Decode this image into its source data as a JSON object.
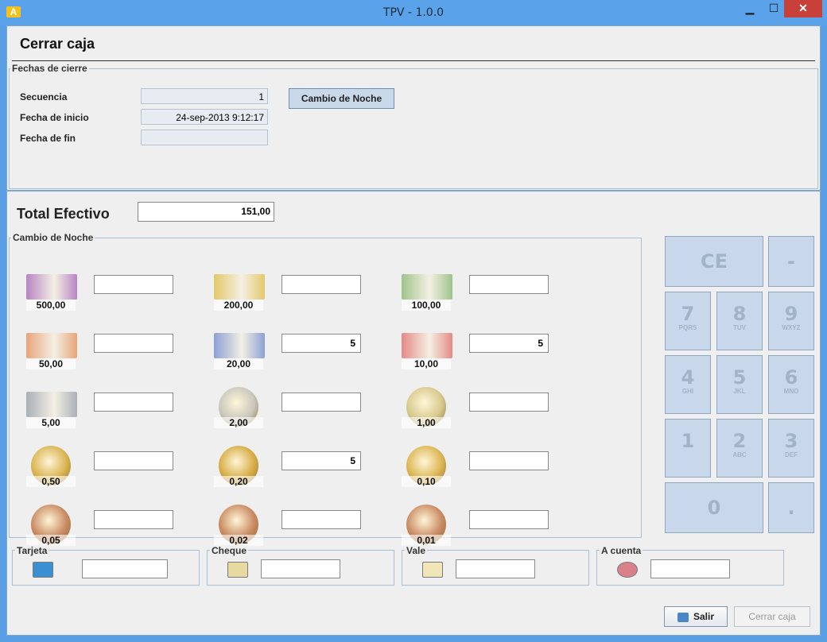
{
  "window": {
    "title": "TPV - 1.0.0",
    "app_icon_text": "A",
    "min": "▁",
    "max": "☐",
    "close": "✕"
  },
  "page": {
    "title": "Cerrar caja"
  },
  "fechas": {
    "legend": "Fechas de cierre",
    "secuencia_label": "Secuencia",
    "secuencia_value": "1",
    "inicio_label": "Fecha de inicio",
    "inicio_value": "24-sep-2013 9:12:17",
    "fin_label": "Fecha de fin",
    "fin_value": "",
    "cambio_button": "Cambio de Noche"
  },
  "total": {
    "label": "Total Efectivo",
    "value": "151,00"
  },
  "cambio": {
    "legend": "Cambio de Noche",
    "denominations": [
      {
        "label": "500,00",
        "kind": "note",
        "color": "#b784c2",
        "value": ""
      },
      {
        "label": "200,00",
        "kind": "note",
        "color": "#e3c86a",
        "value": ""
      },
      {
        "label": "100,00",
        "kind": "note",
        "color": "#9fc38a",
        "value": ""
      },
      {
        "label": "50,00",
        "kind": "note",
        "color": "#e7a57a",
        "value": ""
      },
      {
        "label": "20,00",
        "kind": "note",
        "color": "#8d9fd6",
        "value": "5"
      },
      {
        "label": "10,00",
        "kind": "note",
        "color": "#e58a86",
        "value": "5"
      },
      {
        "label": "5,00",
        "kind": "note",
        "color": "#a9b0b8",
        "value": ""
      },
      {
        "label": "2,00",
        "kind": "coin",
        "color": "#c9c7bd",
        "value": ""
      },
      {
        "label": "1,00",
        "kind": "coin",
        "color": "#d7c98d",
        "value": ""
      },
      {
        "label": "0,50",
        "kind": "coin",
        "color": "#d9b450",
        "value": ""
      },
      {
        "label": "0,20",
        "kind": "coin",
        "color": "#d6ad45",
        "value": "5"
      },
      {
        "label": "0,10",
        "kind": "coin",
        "color": "#dcb653",
        "value": ""
      },
      {
        "label": "0,05",
        "kind": "coin",
        "color": "#c98a62",
        "value": ""
      },
      {
        "label": "0,02",
        "kind": "coin",
        "color": "#c98a62",
        "value": ""
      },
      {
        "label": "0,01",
        "kind": "coin",
        "color": "#c98a62",
        "value": ""
      }
    ]
  },
  "keypad": {
    "keys": [
      {
        "main": "CE",
        "sub": ""
      },
      {
        "main": "-",
        "sub": ""
      },
      {
        "main": "7",
        "sub": "PQRS"
      },
      {
        "main": "8",
        "sub": "TUV"
      },
      {
        "main": "9",
        "sub": "WXYZ"
      },
      {
        "main": "4",
        "sub": "GHI"
      },
      {
        "main": "5",
        "sub": "JKL"
      },
      {
        "main": "6",
        "sub": "MNO"
      },
      {
        "main": "1",
        "sub": ""
      },
      {
        "main": "2",
        "sub": "ABC"
      },
      {
        "main": "3",
        "sub": "DEF"
      },
      {
        "main": "0",
        "sub": ""
      },
      {
        "main": ".",
        "sub": ""
      }
    ]
  },
  "payments": [
    {
      "label": "Tarjeta",
      "icon": "credit-card-icon",
      "value": ""
    },
    {
      "label": "Cheque",
      "icon": "cheque-icon",
      "value": ""
    },
    {
      "label": "Vale",
      "icon": "notepad-icon",
      "value": ""
    },
    {
      "label": "A cuenta",
      "icon": "customer-icon",
      "value": ""
    }
  ],
  "buttons": {
    "salir": "Salir",
    "cerrar": "Cerrar caja"
  }
}
